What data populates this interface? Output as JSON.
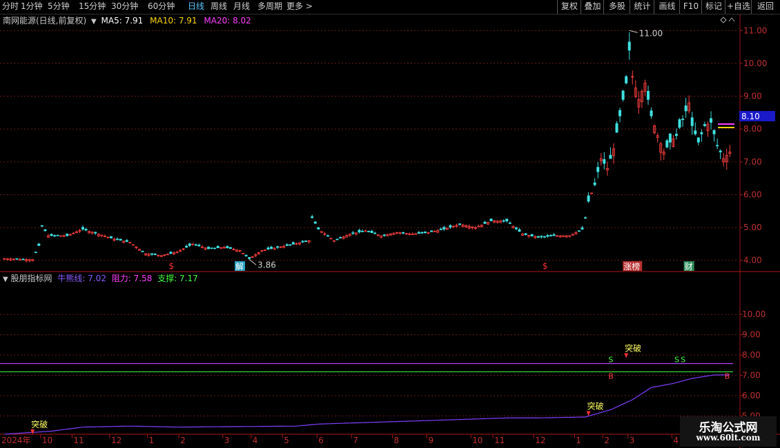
{
  "toolbar": {
    "periods": [
      "分时",
      "1分钟",
      "5分钟",
      "15分钟",
      "30分钟",
      "60分钟",
      "日线",
      "周线",
      "月线",
      "多周期",
      "更多 >"
    ],
    "active_period": "日线",
    "actions": [
      "复权",
      "叠加",
      "多股",
      "统计",
      "画线",
      "F10",
      "标记",
      "+自选",
      "返回"
    ]
  },
  "main_legend": {
    "title": "南网能源(日线,前复权)",
    "ma5_label": "MA5: 7.91",
    "ma10_label": "MA10: 7.91",
    "ma20_label": "MA20: 8.02"
  },
  "indicator_legend": {
    "title": "股朋指标网",
    "bull_label": "牛熊线: 7.02",
    "resist_label": "阻力: 7.58",
    "support_label": "支撑: 7.17"
  },
  "colors": {
    "up": "#ff4040",
    "down": "#40e0e0",
    "grid": "#6a1a1a",
    "axis": "#a01818",
    "ma5": "#ffffff",
    "ma10": "#ffd700",
    "ma20": "#ff40ff",
    "bull_line": "#8040ff",
    "resist_line": "#c040ff",
    "support_line": "#40ff40",
    "price_tag_bg": "#1a1ac8"
  },
  "chart_data": [
    {
      "type": "candlestick",
      "name": "南网能源(日线,前复权)",
      "ylim": [
        3.7,
        11.3
      ],
      "yticks": [
        4.0,
        5.0,
        6.0,
        7.0,
        8.0,
        9.0,
        10.0,
        11.0
      ],
      "current_price_tag": "8.10",
      "high_annotation": {
        "label": "11.00",
        "value": 11.0,
        "index": 199
      },
      "low_annotation": {
        "label": "3.86",
        "value": 3.86,
        "index": 78
      },
      "event_markers": [
        {
          "label": "$",
          "index": 53
        },
        {
          "label": "解",
          "index": 75
        },
        {
          "label": "$",
          "index": 172
        },
        {
          "label": "涨榜",
          "index": 200
        },
        {
          "label": "财",
          "index": 218
        }
      ],
      "keypoints": [
        [
          0,
          4.05
        ],
        [
          9,
          4.02
        ],
        [
          11,
          4.45
        ],
        [
          12,
          5.05
        ],
        [
          14,
          4.75
        ],
        [
          20,
          4.75
        ],
        [
          25,
          4.95
        ],
        [
          30,
          4.8
        ],
        [
          35,
          4.65
        ],
        [
          40,
          4.55
        ],
        [
          45,
          4.2
        ],
        [
          50,
          4.15
        ],
        [
          55,
          4.25
        ],
        [
          60,
          4.5
        ],
        [
          65,
          4.35
        ],
        [
          70,
          4.4
        ],
        [
          75,
          4.3
        ],
        [
          78,
          4.05
        ],
        [
          82,
          4.3
        ],
        [
          90,
          4.45
        ],
        [
          97,
          4.6
        ],
        [
          98,
          5.3
        ],
        [
          100,
          4.95
        ],
        [
          105,
          4.6
        ],
        [
          110,
          4.8
        ],
        [
          115,
          4.9
        ],
        [
          120,
          4.75
        ],
        [
          125,
          4.85
        ],
        [
          130,
          4.8
        ],
        [
          135,
          4.85
        ],
        [
          140,
          4.95
        ],
        [
          145,
          5.1
        ],
        [
          150,
          5.0
        ],
        [
          155,
          5.2
        ],
        [
          160,
          5.2
        ],
        [
          165,
          4.8
        ],
        [
          170,
          4.7
        ],
        [
          175,
          4.75
        ],
        [
          180,
          4.75
        ],
        [
          184,
          4.95
        ],
        [
          185,
          5.3
        ],
        [
          186,
          5.8
        ],
        [
          188,
          6.3
        ],
        [
          190,
          7.1
        ],
        [
          192,
          6.8
        ],
        [
          194,
          7.4
        ],
        [
          196,
          8.4
        ],
        [
          198,
          9.4
        ],
        [
          199,
          10.4
        ],
        [
          200,
          9.6
        ],
        [
          202,
          8.9
        ],
        [
          204,
          9.4
        ],
        [
          206,
          8.4
        ],
        [
          208,
          7.8
        ],
        [
          210,
          7.3
        ],
        [
          212,
          7.6
        ],
        [
          214,
          7.8
        ],
        [
          216,
          8.3
        ],
        [
          218,
          8.8
        ],
        [
          219,
          8.1
        ],
        [
          221,
          7.6
        ],
        [
          223,
          8.1
        ],
        [
          225,
          8.2
        ],
        [
          227,
          7.5
        ],
        [
          229,
          7.1
        ],
        [
          231,
          7.3
        ]
      ]
    },
    {
      "type": "line",
      "name": "股朋指标网",
      "ylim": [
        4.1,
        11.5
      ],
      "yticks": [
        5.0,
        6.0,
        7.0,
        8.0,
        9.0,
        10.0
      ],
      "series": [
        {
          "name": "牛熊线",
          "keypoints": [
            [
              0,
              4.1
            ],
            [
              15,
              4.25
            ],
            [
              25,
              4.45
            ],
            [
              40,
              4.5
            ],
            [
              55,
              4.45
            ],
            [
              93,
              4.5
            ],
            [
              100,
              4.6
            ],
            [
              130,
              4.75
            ],
            [
              160,
              4.9
            ],
            [
              170,
              4.9
            ],
            [
              185,
              4.95
            ],
            [
              193,
              5.3
            ],
            [
              200,
              5.8
            ],
            [
              206,
              6.4
            ],
            [
              213,
              6.6
            ],
            [
              219,
              6.85
            ],
            [
              226,
              7.02
            ],
            [
              231,
              7.02
            ]
          ]
        },
        {
          "name": "阻力",
          "value": 7.58
        },
        {
          "name": "支撑",
          "value": 7.17
        }
      ],
      "markers": [
        {
          "label": "突破",
          "index": 9,
          "value": 4.1
        },
        {
          "label": "突破",
          "index": 186,
          "value": 5.0
        },
        {
          "label": "突破",
          "index": 198,
          "value": 7.85
        },
        {
          "label": "S",
          "index": 193,
          "value": 7.58
        },
        {
          "label": "B",
          "index": 193,
          "value": 7.17
        },
        {
          "label": "S",
          "index": 214,
          "value": 7.58
        },
        {
          "label": "S",
          "index": 216,
          "value": 7.58
        },
        {
          "label": "B",
          "index": 230,
          "value": 7.17
        }
      ]
    }
  ],
  "x_axis": {
    "labels": [
      {
        "text": "2024年",
        "index": 0
      },
      {
        "text": "10",
        "index": 12
      },
      {
        "text": "11",
        "index": 22
      },
      {
        "text": "12",
        "index": 34
      },
      {
        "text": "1",
        "index": 46
      },
      {
        "text": "2",
        "index": 56
      },
      {
        "text": "3",
        "index": 70
      },
      {
        "text": "4",
        "index": 79
      },
      {
        "text": "5",
        "index": 89
      },
      {
        "text": "6",
        "index": 100
      },
      {
        "text": "7",
        "index": 111
      },
      {
        "text": "8",
        "index": 124
      },
      {
        "text": "9",
        "index": 135
      },
      {
        "text": "10",
        "index": 149
      },
      {
        "text": "11",
        "index": 156
      },
      {
        "text": "12",
        "index": 169
      },
      {
        "text": "1",
        "index": 182
      },
      {
        "text": "2",
        "index": 191
      },
      {
        "text": "3",
        "index": 199
      },
      {
        "text": "4",
        "index": 213
      }
    ]
  },
  "watermark": {
    "title": "乐淘公式网",
    "url": "www.60lt.com"
  }
}
